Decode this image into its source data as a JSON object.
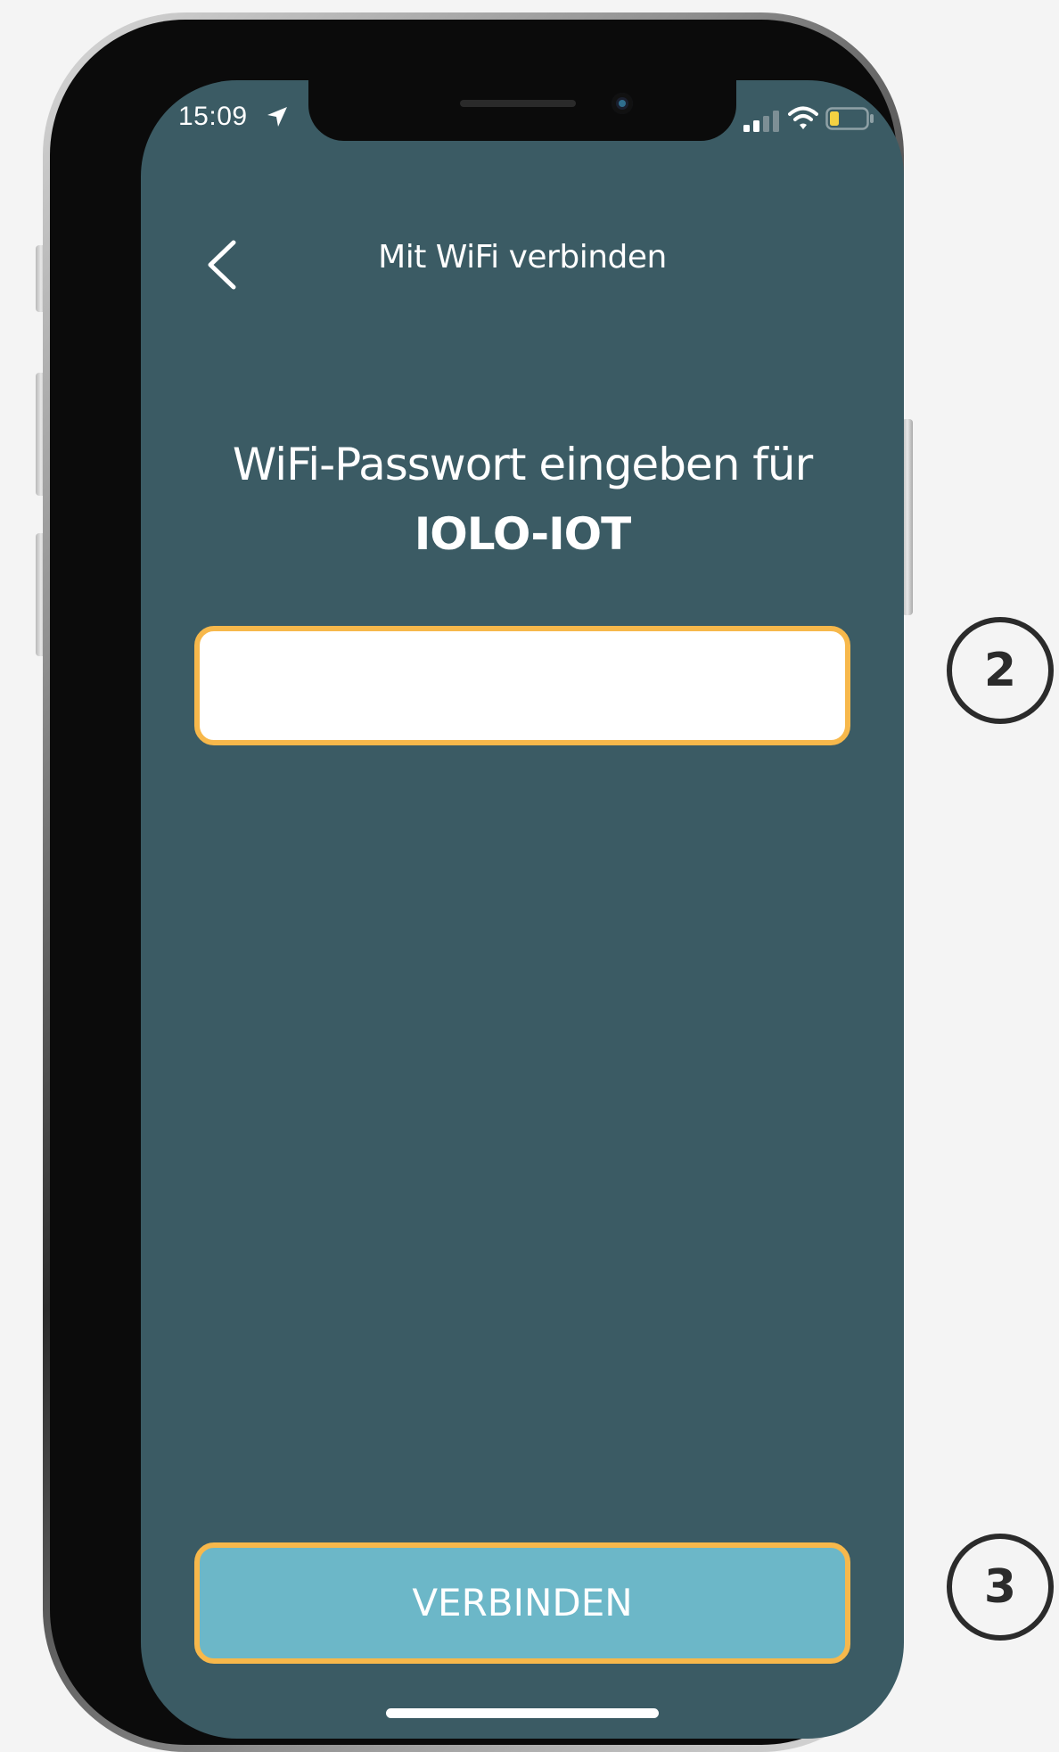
{
  "status_bar": {
    "time": "15:09",
    "location_icon": "location-arrow-icon",
    "signal_icon": "cellular-signal-icon",
    "wifi_icon": "wifi-icon",
    "battery_icon": "battery-low-icon",
    "battery_color": "#f5d142"
  },
  "header": {
    "back_icon": "chevron-left-icon",
    "title": "Mit WiFi verbinden"
  },
  "prompt": {
    "line1": "WiFi-Passwort eingeben für",
    "ssid": "IOLO-IOT"
  },
  "password_field": {
    "value": "",
    "placeholder": ""
  },
  "connect_button": {
    "label": "VERBINDEN"
  },
  "step_badges": {
    "password_step": "2",
    "connect_step": "3"
  },
  "colors": {
    "screen_background": "#3b5b64",
    "highlight_border": "#f7b84b",
    "button_background": "#6cb7c8",
    "text": "#ffffff"
  }
}
